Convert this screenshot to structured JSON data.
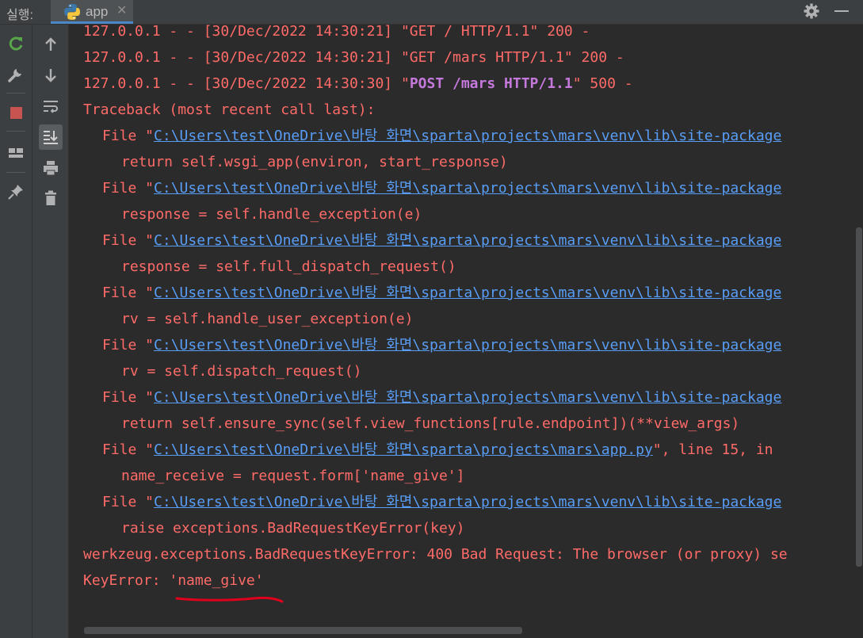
{
  "topbar": {
    "run_label": "실행:",
    "tab_label": "app",
    "tab_close": "✕",
    "settings_icon": "gear-icon",
    "minimize_icon": "minimize-icon"
  },
  "toolbar_left": [
    {
      "icon": "rerun-icon",
      "color": "#57a64a"
    },
    {
      "icon": "wrench-icon"
    },
    {
      "icon": "stop-icon",
      "color": "#c75450"
    },
    {
      "icon": "layout-icon"
    },
    {
      "icon": "pin-icon"
    }
  ],
  "toolbar_right": [
    {
      "icon": "arrow-up-icon"
    },
    {
      "icon": "arrow-down-icon"
    },
    {
      "icon": "soft-wrap-icon"
    },
    {
      "icon": "scroll-to-end-icon",
      "active": true
    },
    {
      "icon": "print-icon"
    },
    {
      "icon": "trash-icon"
    }
  ],
  "console": {
    "log1": "127.0.0.1 - - [30/Dec/2022 14:30:21] \"GET / HTTP/1.1\" 200 -",
    "log2": "127.0.0.1 - - [30/Dec/2022 14:30:21] \"GET /mars HTTP/1.1\" 200 -",
    "log3_prefix": "127.0.0.1 - - [30/Dec/2022 14:30:30] \"",
    "log3_method": "POST /mars HTTP/1.1",
    "log3_suffix": "\" 500 -",
    "traceback": "Traceback (most recent call last):",
    "file_prefix": "File \"",
    "path_pkg": "C:\\Users\\test\\OneDrive\\바탕 화면\\sparta\\projects\\mars\\venv\\lib\\site-package",
    "path_app": "C:\\Users\\test\\OneDrive\\바탕 화면\\sparta\\projects\\mars\\app.py",
    "app_suffix": "\", line 15, in",
    "code1": "return self.wsgi_app(environ, start_response)",
    "code2": "response = self.handle_exception(e)",
    "code3": "response = self.full_dispatch_request()",
    "code4": "rv = self.handle_user_exception(e)",
    "code5": "rv = self.dispatch_request()",
    "code6": "return self.ensure_sync(self.view_functions[rule.endpoint])(**view_args)",
    "code7": "name_receive = request.form['name_give']",
    "code8": "raise exceptions.BadRequestKeyError(key)",
    "error": "werkzeug.exceptions.BadRequestKeyError: 400 Bad Request: The browser (or proxy) se",
    "key_error": "KeyError: 'name_give'"
  },
  "colors": {
    "error_text": "#ff6b68",
    "link": "#589df6",
    "http_method": "#c679dd",
    "annotation_underline": "#e0001b"
  }
}
